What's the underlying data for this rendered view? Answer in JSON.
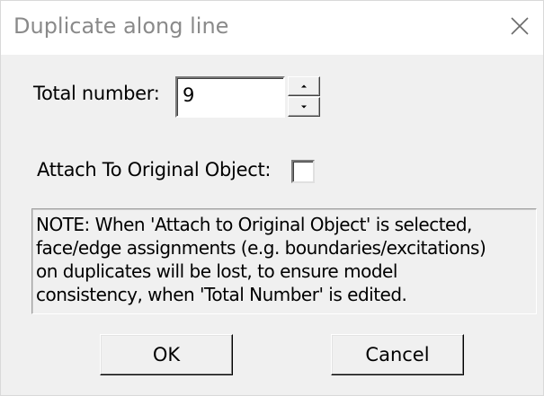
{
  "window": {
    "title": "Duplicate along line",
    "close_icon": "close-icon"
  },
  "form": {
    "total_number_label": "Total number:",
    "total_number_value": "9",
    "attach_label": "Attach To Original Object:",
    "attach_checked": false
  },
  "note": {
    "lines": [
      "NOTE:  When 'Attach to Original Object' is selected,",
      "face/edge assignments (e.g. boundaries/excitations)",
      "on duplicates will be lost, to ensure model",
      "consistency, when 'Total Number' is edited."
    ]
  },
  "buttons": {
    "ok_label": "OK",
    "cancel_label": "Cancel"
  }
}
